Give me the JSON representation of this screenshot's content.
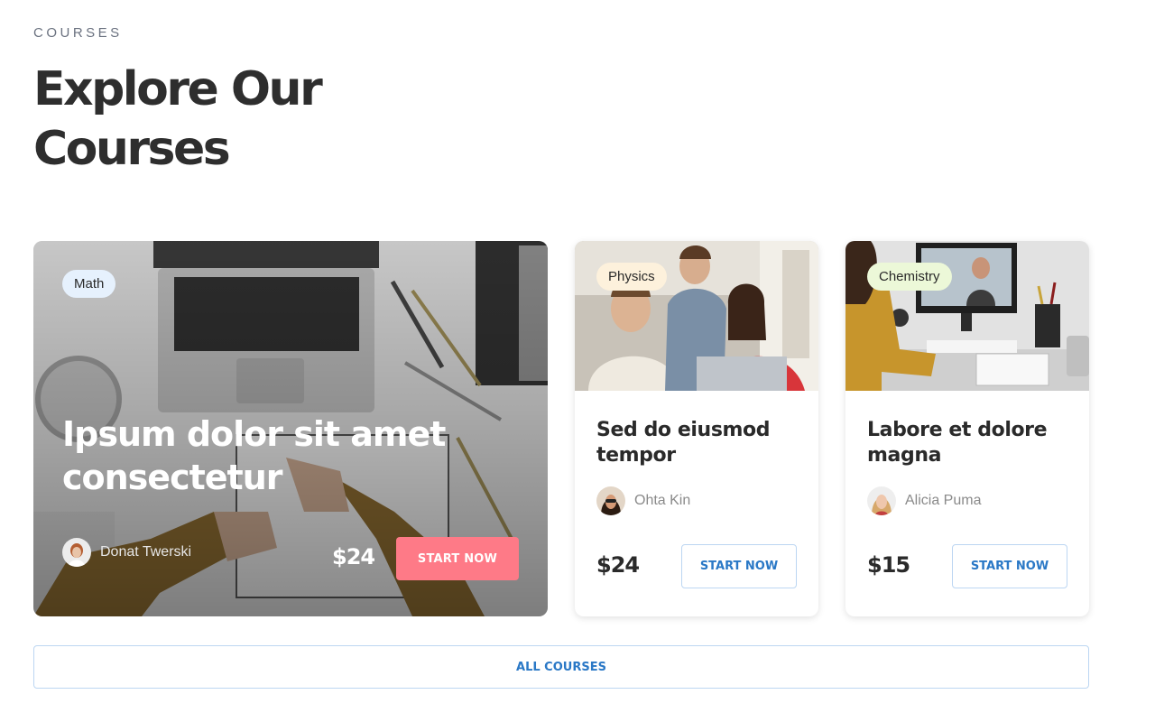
{
  "section": {
    "eyebrow": "COURSES",
    "title": "Explore Our Courses"
  },
  "courses": [
    {
      "tag": "Math",
      "tag_color": "#e6f1fd",
      "title": "Ipsum dolor sit amet consectetur",
      "author": "Donat Twerski",
      "price": "$24",
      "cta": "START NOW"
    },
    {
      "tag": "Physics",
      "tag_color": "#fdf1dc",
      "title": "Sed do eiusmod tempor",
      "author": "Ohta Kin",
      "price": "$24",
      "cta": "START NOW"
    },
    {
      "tag": "Chemistry",
      "tag_color": "#ecf8d8",
      "title": "Labore et dolore magna",
      "author": "Alicia Puma",
      "price": "$15",
      "cta": "START NOW"
    }
  ],
  "footer": {
    "all_courses": "ALL COURSES"
  },
  "colors": {
    "featured_cta": "#fe7a87",
    "outline_cta_text": "#2a78c6",
    "outline_cta_border": "#bcd6f2"
  }
}
